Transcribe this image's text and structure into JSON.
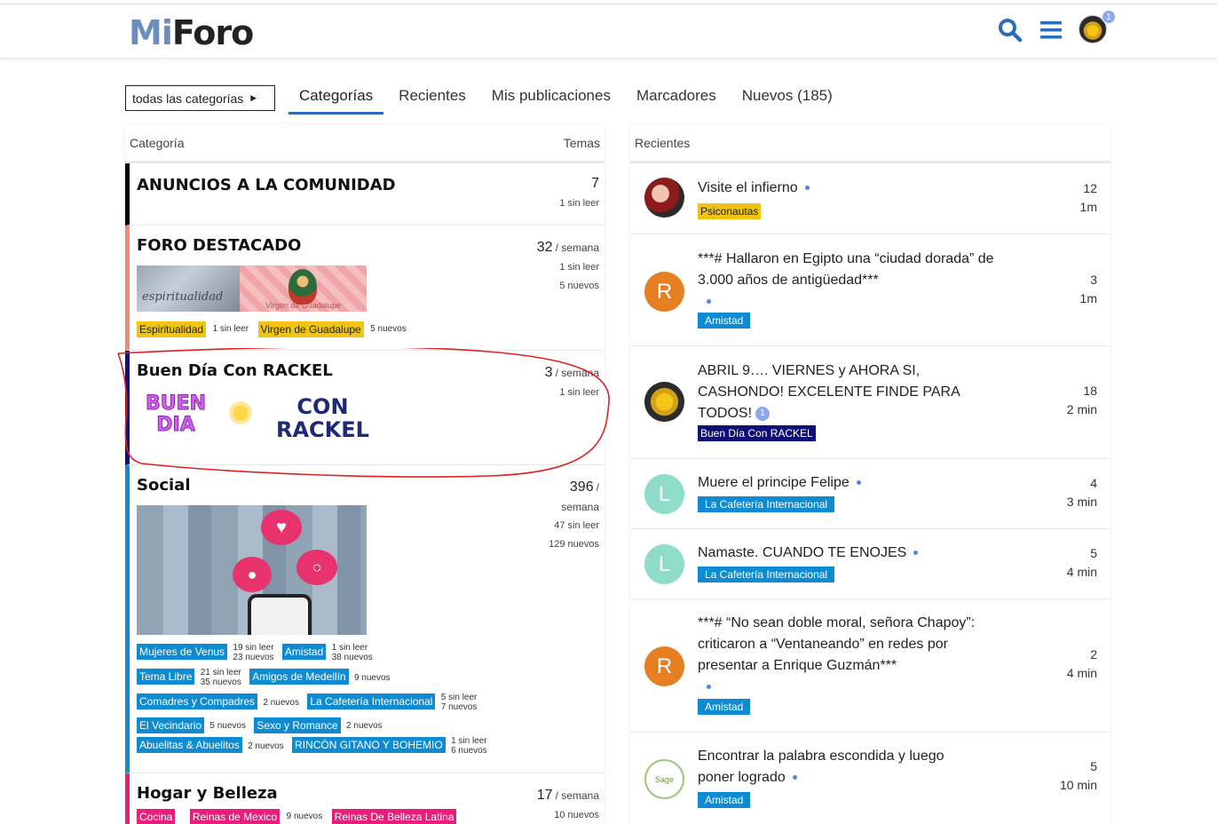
{
  "header": {
    "logo_mi": "Mi",
    "logo_foro": "Foro",
    "notification_count": "1"
  },
  "nav": {
    "categories_dropdown": "todas las categorías",
    "tabs": [
      {
        "label": "Categorías",
        "active": true
      },
      {
        "label": "Recientes",
        "active": false
      },
      {
        "label": "Mis publicaciones",
        "active": false
      },
      {
        "label": "Marcadores",
        "active": false
      },
      {
        "label": "Nuevos (185)",
        "active": false
      }
    ]
  },
  "categories_panel": {
    "col_category": "Categoría",
    "col_topics": "Temas",
    "rows": [
      {
        "name": "ANUNCIOS A LA COMUNIDAD",
        "color": "#000000",
        "count": "7",
        "per": "",
        "unread": "1 sin leer",
        "new": ""
      },
      {
        "name": "FORO DESTACADO",
        "color": "#f08b7a",
        "count": "32",
        "per": "/ semana",
        "unread": "1 sin leer",
        "new": "5 nuevos",
        "images": [
          "espiritualidad",
          "Virgen de Guadalupe"
        ],
        "subcats": [
          {
            "label": "Espiritualidad",
            "meta": "1 sin leer",
            "color": "#f1c40f"
          },
          {
            "label": "Virgen de Guadalupe",
            "meta": "5 nuevos",
            "color": "#f1c40f"
          }
        ]
      },
      {
        "name": "Buen Día Con RACKEL",
        "color": "#0f0e76",
        "count": "3",
        "per": "/ semana",
        "unread": "1 sin leer",
        "new": "",
        "logo_line1": "BUEN",
        "logo_line2": "DIA",
        "logo_right1": "CON",
        "logo_right2": "RACKEL"
      },
      {
        "name": "Social",
        "color": "#0e8bd1",
        "count": "396",
        "per": "/",
        "per2": "semana",
        "unread": "47 sin leer",
        "new": "129 nuevos",
        "subcats": [
          {
            "label": "Mujeres de Venus",
            "meta1": "19 sin leer",
            "meta2": "23 nuevos"
          },
          {
            "label": "Amistad",
            "meta1": "1 sin leer",
            "meta2": "38 nuevos"
          },
          {
            "label": "Tema Libre",
            "meta1": "21 sin leer",
            "meta2": "35 nuevos"
          },
          {
            "label": "Amigos de Medellín",
            "meta1": "9 nuevos",
            "meta2": ""
          },
          {
            "label": "Comadres y Compadres",
            "meta1": "2 nuevos",
            "meta2": ""
          },
          {
            "label": "La Cafetería Internacional",
            "meta1": "5 sin leer",
            "meta2": "7 nuevos"
          },
          {
            "label": "El Vecindario",
            "meta1": "5 nuevos",
            "meta2": ""
          },
          {
            "label": "Sexo y Romance",
            "meta1": "2 nuevos",
            "meta2": ""
          },
          {
            "label": "Abuelitas & Abuelitos",
            "meta1": "2 nuevos",
            "meta2": ""
          },
          {
            "label": "RINCÓN GITANO Y BOHEMIO",
            "meta1": "1 sin leer",
            "meta2": "6 nuevos"
          }
        ]
      },
      {
        "name": "Hogar y Belleza",
        "color": "#e91e7a",
        "count": "17",
        "per": "/ semana",
        "unread": "",
        "new": "10 nuevos",
        "subcats": [
          {
            "label": "Cocina",
            "meta": ""
          },
          {
            "label": "Reinas de Mexico",
            "meta": "9 nuevos"
          },
          {
            "label": "Reinas De Belleza Latina",
            "meta": ""
          }
        ]
      }
    ]
  },
  "recent_panel": {
    "title": "Recientes",
    "topics": [
      {
        "title": "Visite el infierno",
        "category": "Psiconautas",
        "cat_color": "#f1c40f",
        "cat_text": "#222222",
        "replies": "12",
        "age": "1m",
        "avatar": "",
        "avatar_color": "#8b1a1a"
      },
      {
        "title": "***# Hallaron en Egipto una “ciudad dorada” de 3.000 años de antigüedad***",
        "category": "Amistad",
        "cat_color": "#0e8bd1",
        "cat_text": "#ffffff",
        "replies": "3",
        "age": "1m",
        "avatar": "R",
        "avatar_color": "#e67e22"
      },
      {
        "title": "ABRIL 9…. VIERNES y AHORA SI, CASHONDO! EXCELENTE FINDE PARA TODOS!",
        "badge": "1",
        "category": "Buen Día Con RACKEL",
        "cat_color": "#0f0e76",
        "cat_text": "#ffffff",
        "replies": "18",
        "age": "2 min",
        "avatar": "",
        "avatar_color": "#2b2b2b"
      },
      {
        "title": "Muere el principe Felipe",
        "category": "La Cafetería Internacional",
        "cat_color": "#0e8bd1",
        "cat_text": "#ffffff",
        "replies": "4",
        "age": "3 min",
        "avatar": "L",
        "avatar_color": "#8fdcc8"
      },
      {
        "title": "Namaste. CUANDO TE ENOJES",
        "category": "La Cafetería Internacional",
        "cat_color": "#0e8bd1",
        "cat_text": "#ffffff",
        "replies": "5",
        "age": "4 min",
        "avatar": "L",
        "avatar_color": "#8fdcc8"
      },
      {
        "title": "***# “No sean doble moral, señora Chapoy”: criticaron a “Ventaneando” en redes por presentar a Enrique Guzmán***",
        "category": "Amistad",
        "cat_color": "#0e8bd1",
        "cat_text": "#ffffff",
        "replies": "2",
        "age": "4 min",
        "avatar": "R",
        "avatar_color": "#e67e22"
      },
      {
        "title": "Encontrar la palabra escondida y luego poner logrado",
        "category": "Amistad",
        "cat_color": "#0e8bd1",
        "cat_text": "#ffffff",
        "replies": "5",
        "age": "10 min",
        "avatar": "Sage",
        "avatar_color": "#ffffff"
      }
    ]
  }
}
